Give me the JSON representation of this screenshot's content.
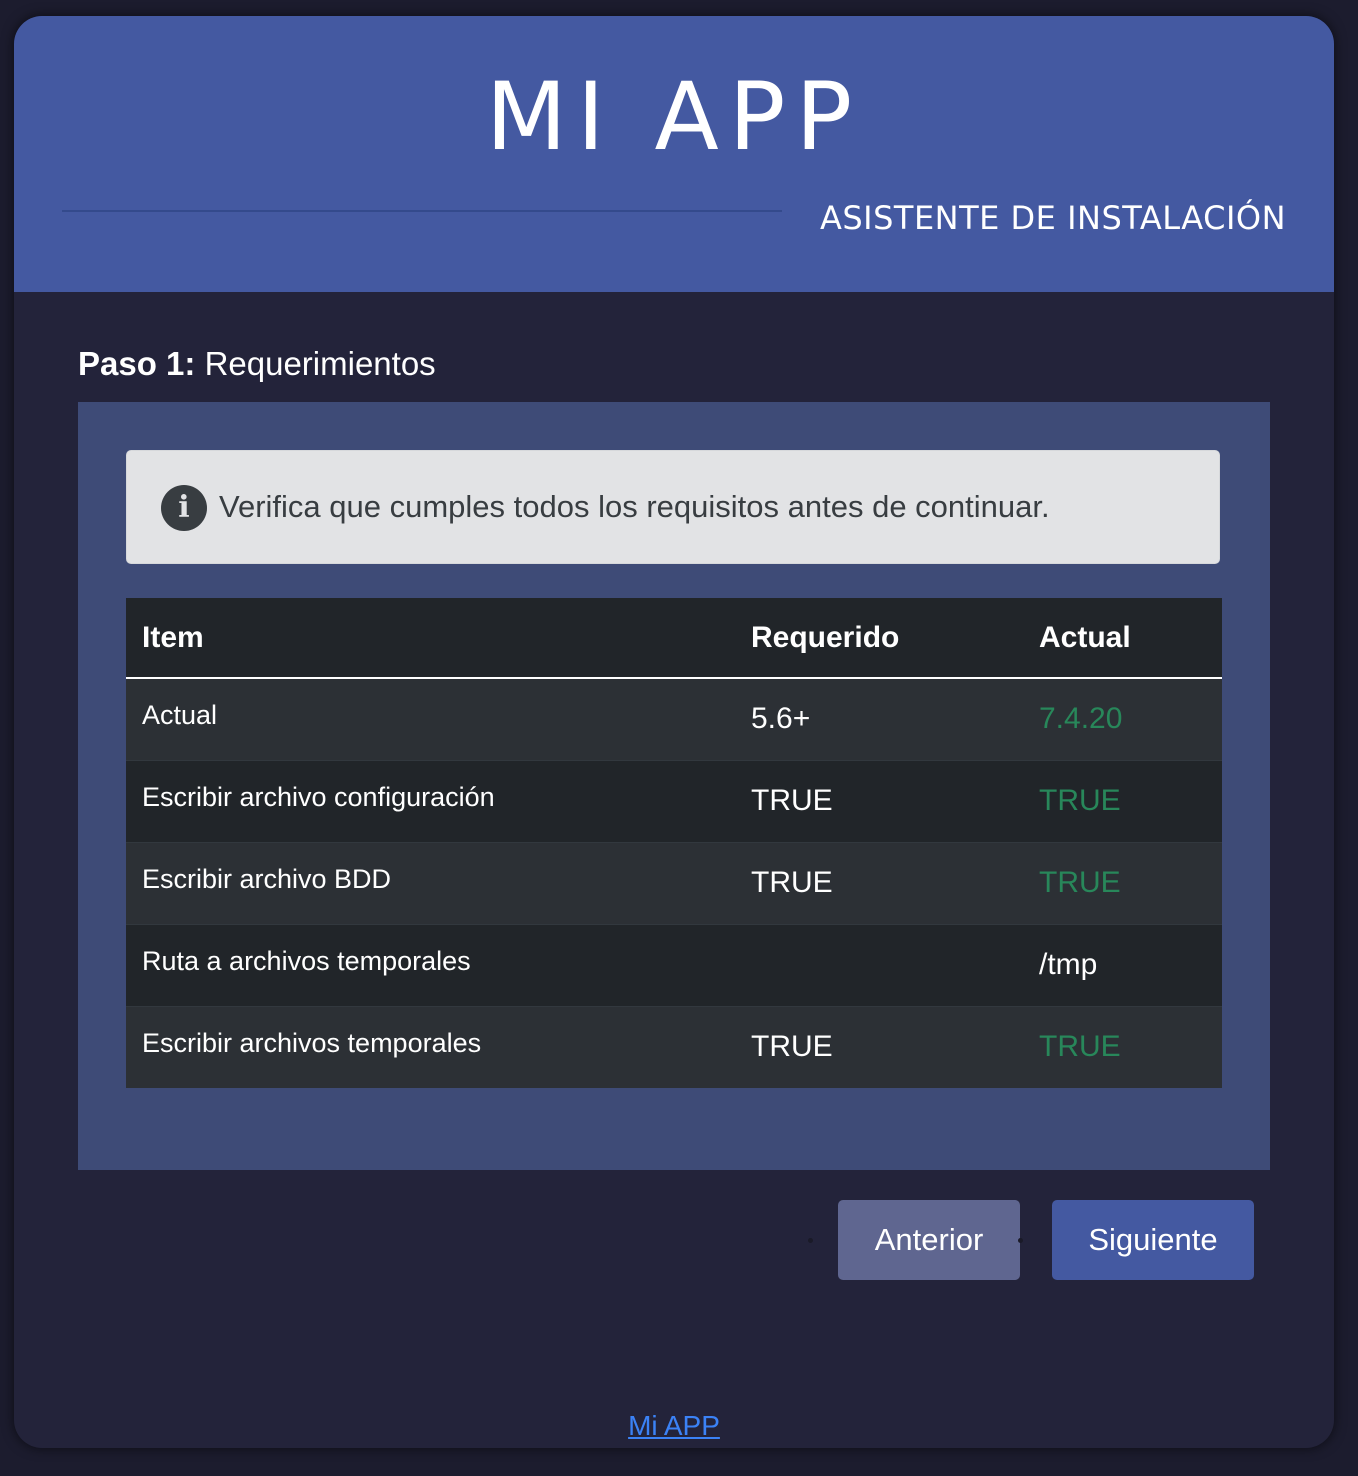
{
  "header": {
    "title": "MI APP",
    "subtitle": "ASISTENTE DE INSTALACIÓN"
  },
  "step": {
    "number": "Paso 1:",
    "name": "Requerimientos"
  },
  "alert": {
    "icon": "info-circle-icon",
    "text": "Verifica que cumples todos los requisitos antes de continuar."
  },
  "table": {
    "headers": [
      "Item",
      "Requerido",
      "Actual"
    ],
    "rows": [
      {
        "item": "Actual",
        "required": "5.6+",
        "actual": "7.4.20",
        "status": "ok"
      },
      {
        "item": "Escribir archivo configuración",
        "required": "TRUE",
        "actual": "TRUE",
        "status": "ok"
      },
      {
        "item": "Escribir archivo BDD",
        "required": "TRUE",
        "actual": "TRUE",
        "status": "ok"
      },
      {
        "item": "Ruta a archivos temporales",
        "required": "",
        "actual": "/tmp",
        "status": "neutral"
      },
      {
        "item": "Escribir archivos temporales",
        "required": "TRUE",
        "actual": "TRUE",
        "status": "ok"
      }
    ]
  },
  "buttons": {
    "previous": "Anterior",
    "next": "Siguiente"
  },
  "footer": {
    "link": "Mi APP"
  },
  "colors": {
    "header": "#4459a1",
    "background": "#23233a",
    "panel": "#3e4b77",
    "ok": "#28875a",
    "link": "#3b82f6"
  }
}
